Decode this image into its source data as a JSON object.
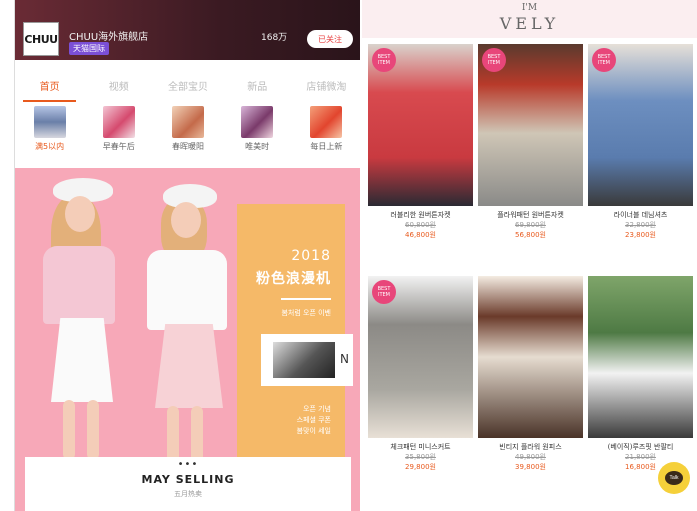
{
  "store": {
    "logo_text": "CHUU",
    "name": "CHUU海外旗舰店",
    "tag": "天猫国际",
    "fans": "168万",
    "follow_label": "已关注"
  },
  "tabs": [
    {
      "label": "首页"
    },
    {
      "label": "视频"
    },
    {
      "label": "全部宝贝"
    },
    {
      "label": "新品"
    },
    {
      "label": "店铺微淘"
    }
  ],
  "categories": [
    {
      "label": "满5以内"
    },
    {
      "label": "早春午后"
    },
    {
      "label": "春晖暖阳"
    },
    {
      "label": "唯美时"
    },
    {
      "label": "每日上新"
    }
  ],
  "banner": {
    "year": "2018",
    "title": "粉色浪漫机",
    "subtitle": "봄처럼 오픈 이벤",
    "foot": [
      "오픈 기념",
      "스페셜 쿠폰",
      "봄맞이 세일"
    ],
    "card_letter": "N"
  },
  "may_selling": {
    "dots": "•••",
    "title": "MAY SELLING",
    "subtitle": "五月热卖"
  },
  "brand": {
    "line1": "I'M",
    "line2": "VELY"
  },
  "products": [
    {
      "badge": "BEST ITEM",
      "name": "러블리한 원버튼자켓",
      "old_price": "60,800원",
      "new_price": "46,800원"
    },
    {
      "badge": "BEST ITEM",
      "name": "플라워패턴 원버튼자켓",
      "old_price": "69,800원",
      "new_price": "56,800원"
    },
    {
      "badge": "BEST ITEM",
      "name": "라이너블 데님셔츠",
      "old_price": "32,800원",
      "new_price": "23,800원"
    },
    {
      "badge": "BEST ITEM",
      "name": "체크패턴 미니스커트",
      "old_price": "35,800원",
      "new_price": "29,800원"
    },
    {
      "badge": "",
      "name": "빈티지 플라워 원피스",
      "old_price": "49,800원",
      "new_price": "39,800원"
    },
    {
      "badge": "",
      "name": "(베이직)루즈핏 반팔티",
      "old_price": "21,800원",
      "new_price": "16,800원"
    }
  ],
  "chat": {
    "label": "Talk"
  }
}
